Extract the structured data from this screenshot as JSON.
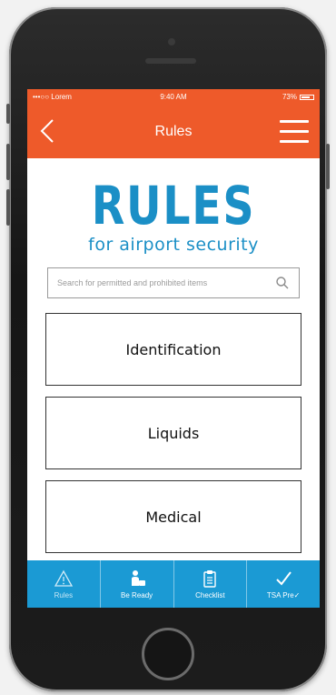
{
  "status_bar": {
    "carrier": "•••○○ Lorem",
    "time": "9:40 AM",
    "battery": "73%",
    "battery_level": 0.73
  },
  "nav": {
    "title": "Rules"
  },
  "heading": {
    "title": "RULES",
    "subtitle": "for airport security"
  },
  "search": {
    "placeholder": "Search for permitted and prohibited items",
    "value": ""
  },
  "categories": [
    {
      "label": "Identification"
    },
    {
      "label": "Liquids"
    },
    {
      "label": "Medical"
    }
  ],
  "tabs": [
    {
      "label": "Rules",
      "icon": "warning-icon",
      "active": true
    },
    {
      "label": "Be Ready",
      "icon": "person-luggage-icon",
      "active": false
    },
    {
      "label": "Checklist",
      "icon": "clipboard-icon",
      "active": false
    },
    {
      "label": "TSA Pre✓",
      "icon": "checkmark-icon",
      "active": false
    }
  ],
  "colors": {
    "header_orange": "#ee5a2a",
    "accent_blue": "#1b8fc6",
    "tab_bar_blue": "#1b9ad4"
  }
}
